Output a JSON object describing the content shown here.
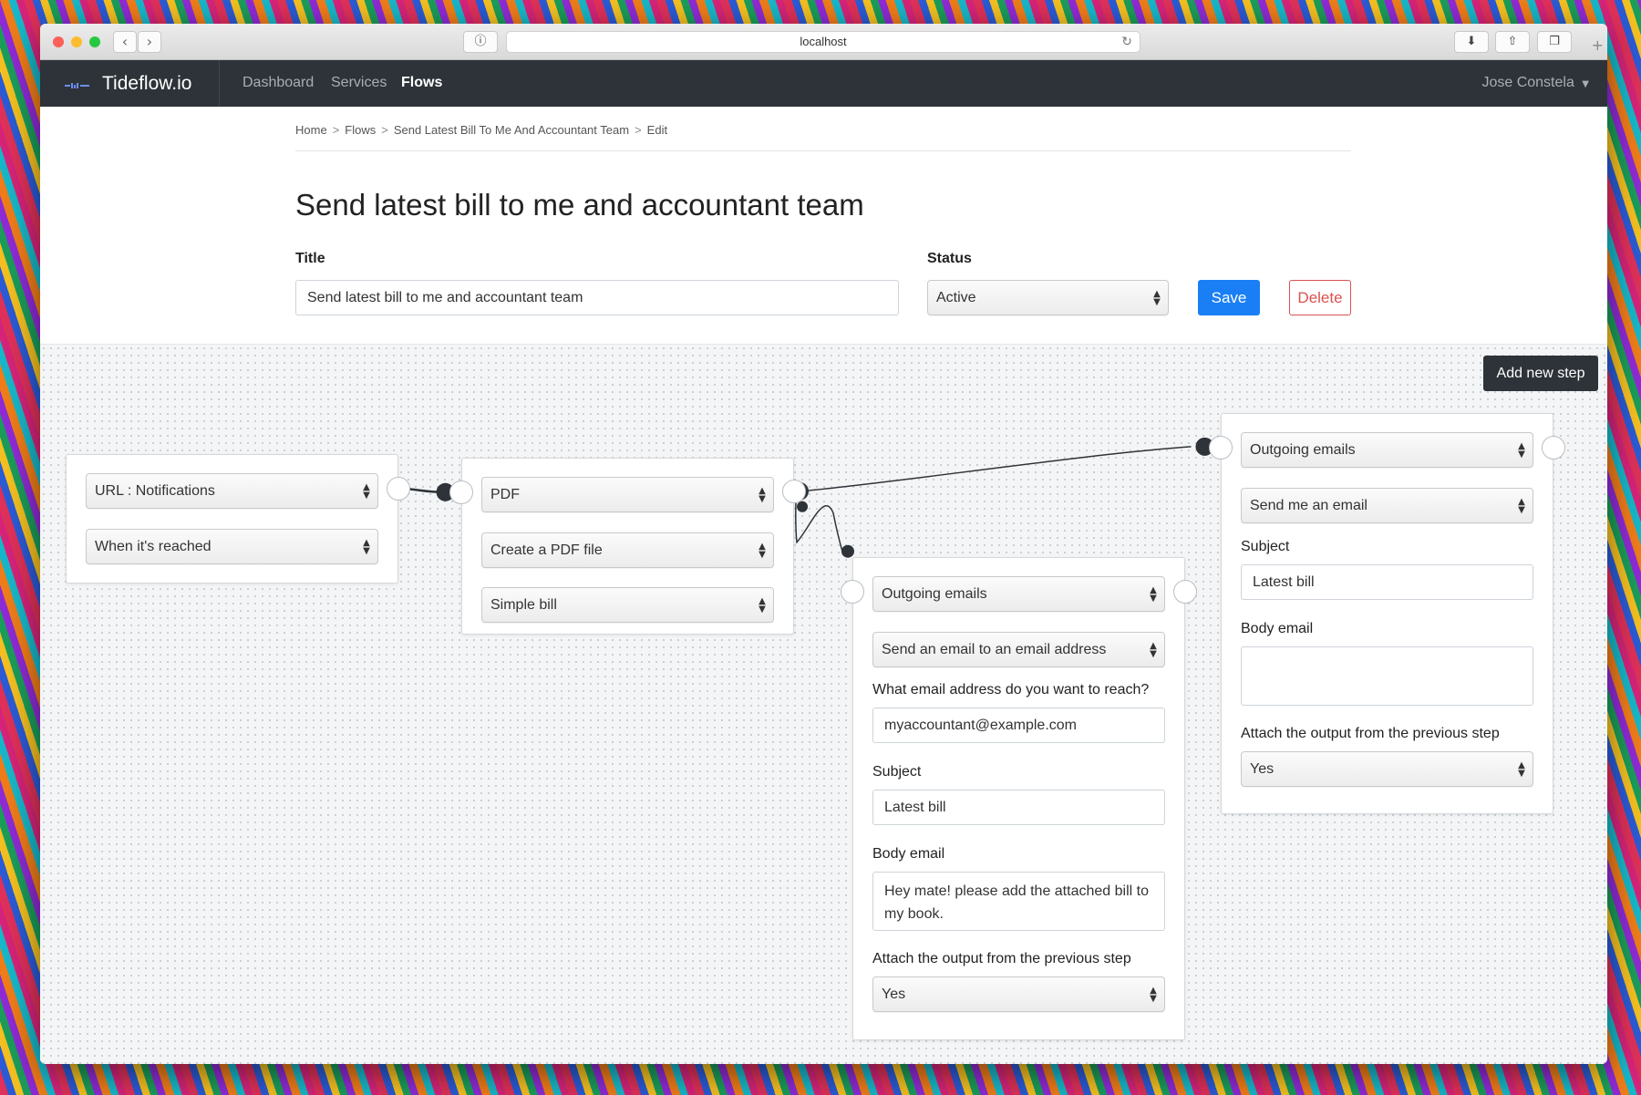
{
  "browser": {
    "url": "localhost"
  },
  "navbar": {
    "brand": "Tideflow.io",
    "links": [
      "Dashboard",
      "Services",
      "Flows"
    ],
    "active_link": "Flows",
    "user": "Jose Constela"
  },
  "breadcrumb": [
    "Home",
    "Flows",
    "Send Latest Bill To Me And Accountant Team",
    "Edit"
  ],
  "page_title": "Send latest bill to me and accountant team",
  "form": {
    "title_label": "Title",
    "title_value": "Send latest bill to me and accountant team",
    "status_label": "Status",
    "status_value": "Active",
    "save_label": "Save",
    "delete_label": "Delete"
  },
  "canvas": {
    "add_step_label": "Add new step",
    "steps": [
      {
        "service": "URL : Notifications",
        "event": "When it's reached"
      },
      {
        "service": "PDF",
        "action": "Create a PDF file",
        "template": "Simple bill"
      },
      {
        "service": "Outgoing emails",
        "action": "Send an email to an email address",
        "email_label": "What email address do you want to reach?",
        "email_value": "myaccountant@example.com",
        "subject_label": "Subject",
        "subject_value": "Latest bill",
        "body_label": "Body email",
        "body_value": "Hey mate! please add the attached bill to my book.",
        "attach_label": "Attach the output from the previous step",
        "attach_value": "Yes"
      },
      {
        "service": "Outgoing emails",
        "action": "Send me an email",
        "subject_label": "Subject",
        "subject_value": "Latest bill",
        "body_label": "Body email",
        "body_value": "",
        "attach_label": "Attach the output from the previous step",
        "attach_value": "Yes"
      }
    ]
  },
  "colors": {
    "navbar_bg": "#2d3338",
    "save_bg": "#1a7ff5",
    "delete_red": "#d9534f",
    "connector": "#2d3338"
  }
}
